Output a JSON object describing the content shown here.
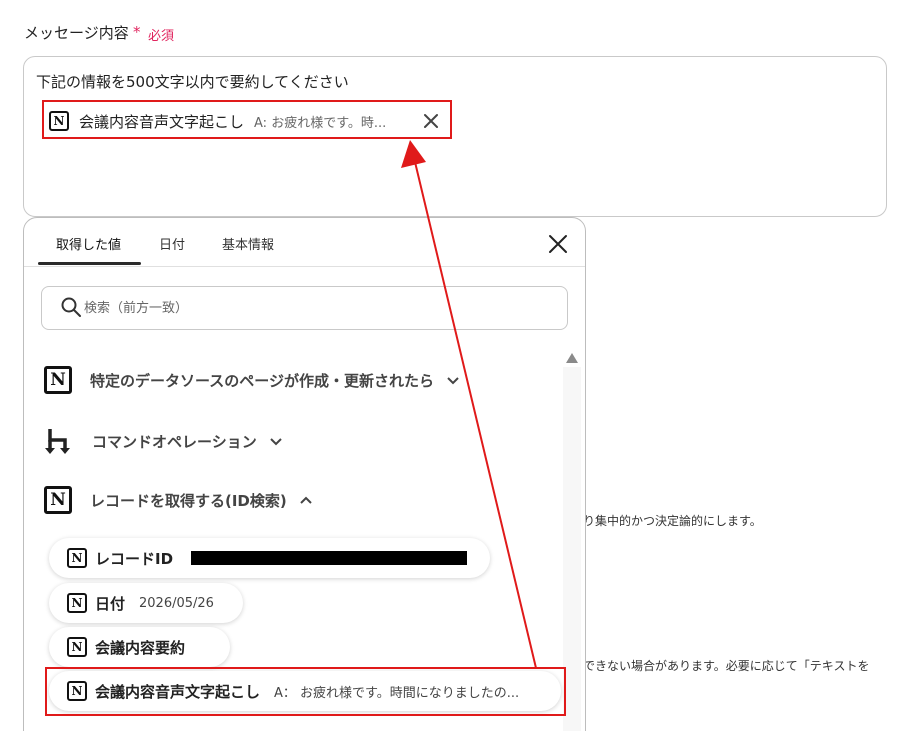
{
  "field": {
    "label": "メッセージ内容",
    "required_mark": "*",
    "required_text": "必須",
    "value_text": "下記の情報を500文字以内で要約してください"
  },
  "chip": {
    "label": "会議内容音声文字起こし",
    "value": "A: お疲れ様です。時..."
  },
  "panel": {
    "tabs": [
      {
        "label": "取得した値"
      },
      {
        "label": "日付"
      },
      {
        "label": "基本情報"
      }
    ],
    "search_placeholder": "検索（前方一致）",
    "sections": [
      {
        "label": "特定のデータソースのページが作成・更新されたら",
        "icon": "notion-icon",
        "expanded": false
      },
      {
        "label": "コマンドオペレーション",
        "icon": "branch-arrow-icon",
        "expanded": false
      },
      {
        "label": "レコードを取得する(ID検索)",
        "icon": "notion-icon",
        "expanded": true
      }
    ],
    "items": [
      {
        "label": "レコードID",
        "value": ""
      },
      {
        "label": "日付",
        "value": "2026/05/26"
      },
      {
        "label": "会議内容要約",
        "value": ""
      },
      {
        "label": "会議内容音声文字起こし",
        "value": "A： お疲れ様です。時間になりましたの..."
      }
    ]
  },
  "background_text": {
    "line1": "り集中的かつ決定論的にします。",
    "line2": "できない場合があります。必要に応じて「テキストを"
  },
  "colors": {
    "required": "#e0245e",
    "highlight": "#e01a1a",
    "tab_active": "#2b2b2b"
  }
}
